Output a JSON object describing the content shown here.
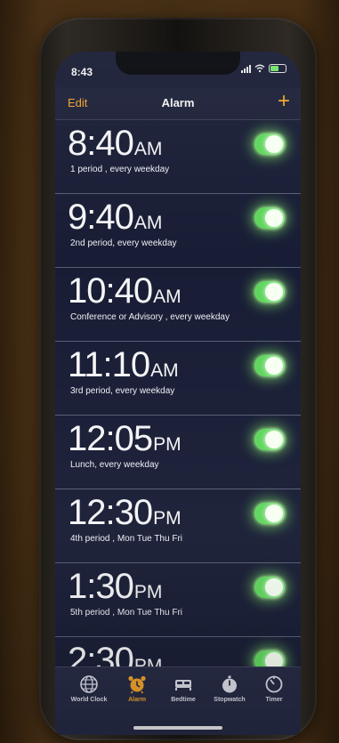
{
  "status_bar": {
    "time": "8:43"
  },
  "nav": {
    "edit_label": "Edit",
    "title": "Alarm",
    "add_label": "+"
  },
  "alarms": [
    {
      "time": "8:40",
      "ampm": "AM",
      "label": "1 period , every weekday",
      "enabled": true
    },
    {
      "time": "9:40",
      "ampm": "AM",
      "label": "2nd period, every weekday",
      "enabled": true
    },
    {
      "time": "10:40",
      "ampm": "AM",
      "label": "Conference or Advisory , every weekday",
      "enabled": true
    },
    {
      "time": "11:10",
      "ampm": "AM",
      "label": "3rd period, every weekday",
      "enabled": true
    },
    {
      "time": "12:05",
      "ampm": "PM",
      "label": "Lunch, every weekday",
      "enabled": true
    },
    {
      "time": "12:30",
      "ampm": "PM",
      "label": "4th period , Mon Tue Thu Fri",
      "enabled": true
    },
    {
      "time": "1:30",
      "ampm": "PM",
      "label": "5th period , Mon Tue Thu Fri",
      "enabled": true
    },
    {
      "time": "2:30",
      "ampm": "PM",
      "label": "",
      "enabled": true
    }
  ],
  "tabs": [
    {
      "label": "World Clock",
      "icon": "globe-icon",
      "active": false
    },
    {
      "label": "Alarm",
      "icon": "alarm-clock-icon",
      "active": true
    },
    {
      "label": "Bedtime",
      "icon": "bed-icon",
      "active": false
    },
    {
      "label": "Stopwatch",
      "icon": "stopwatch-icon",
      "active": false
    },
    {
      "label": "Timer",
      "icon": "timer-icon",
      "active": false
    }
  ],
  "colors": {
    "accent": "#f0a22a",
    "toggle_on": "#5fd65d",
    "screen_bg": "#181d35"
  }
}
